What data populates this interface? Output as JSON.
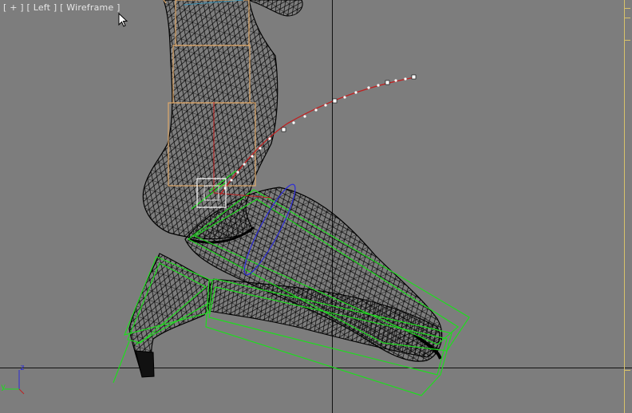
{
  "viewport": {
    "label": {
      "plus": "[ + ]",
      "view": "[ Left ]",
      "shading": "[ Wireframe ]"
    },
    "axis_labels": {
      "vertical": "z",
      "horizontal": "y"
    },
    "colors": {
      "background": "#7d7d7d",
      "mesh": "#000000",
      "bones": "#1fdc1f",
      "bounding_box": "#e0a96a",
      "trajectory": "#c02020",
      "selection_gizmo": "#ffffff",
      "frame_marker": "#d8c26a",
      "manipulator_circle": "#2b2bd8"
    },
    "cursor_icon": "arrow-cursor-icon"
  }
}
